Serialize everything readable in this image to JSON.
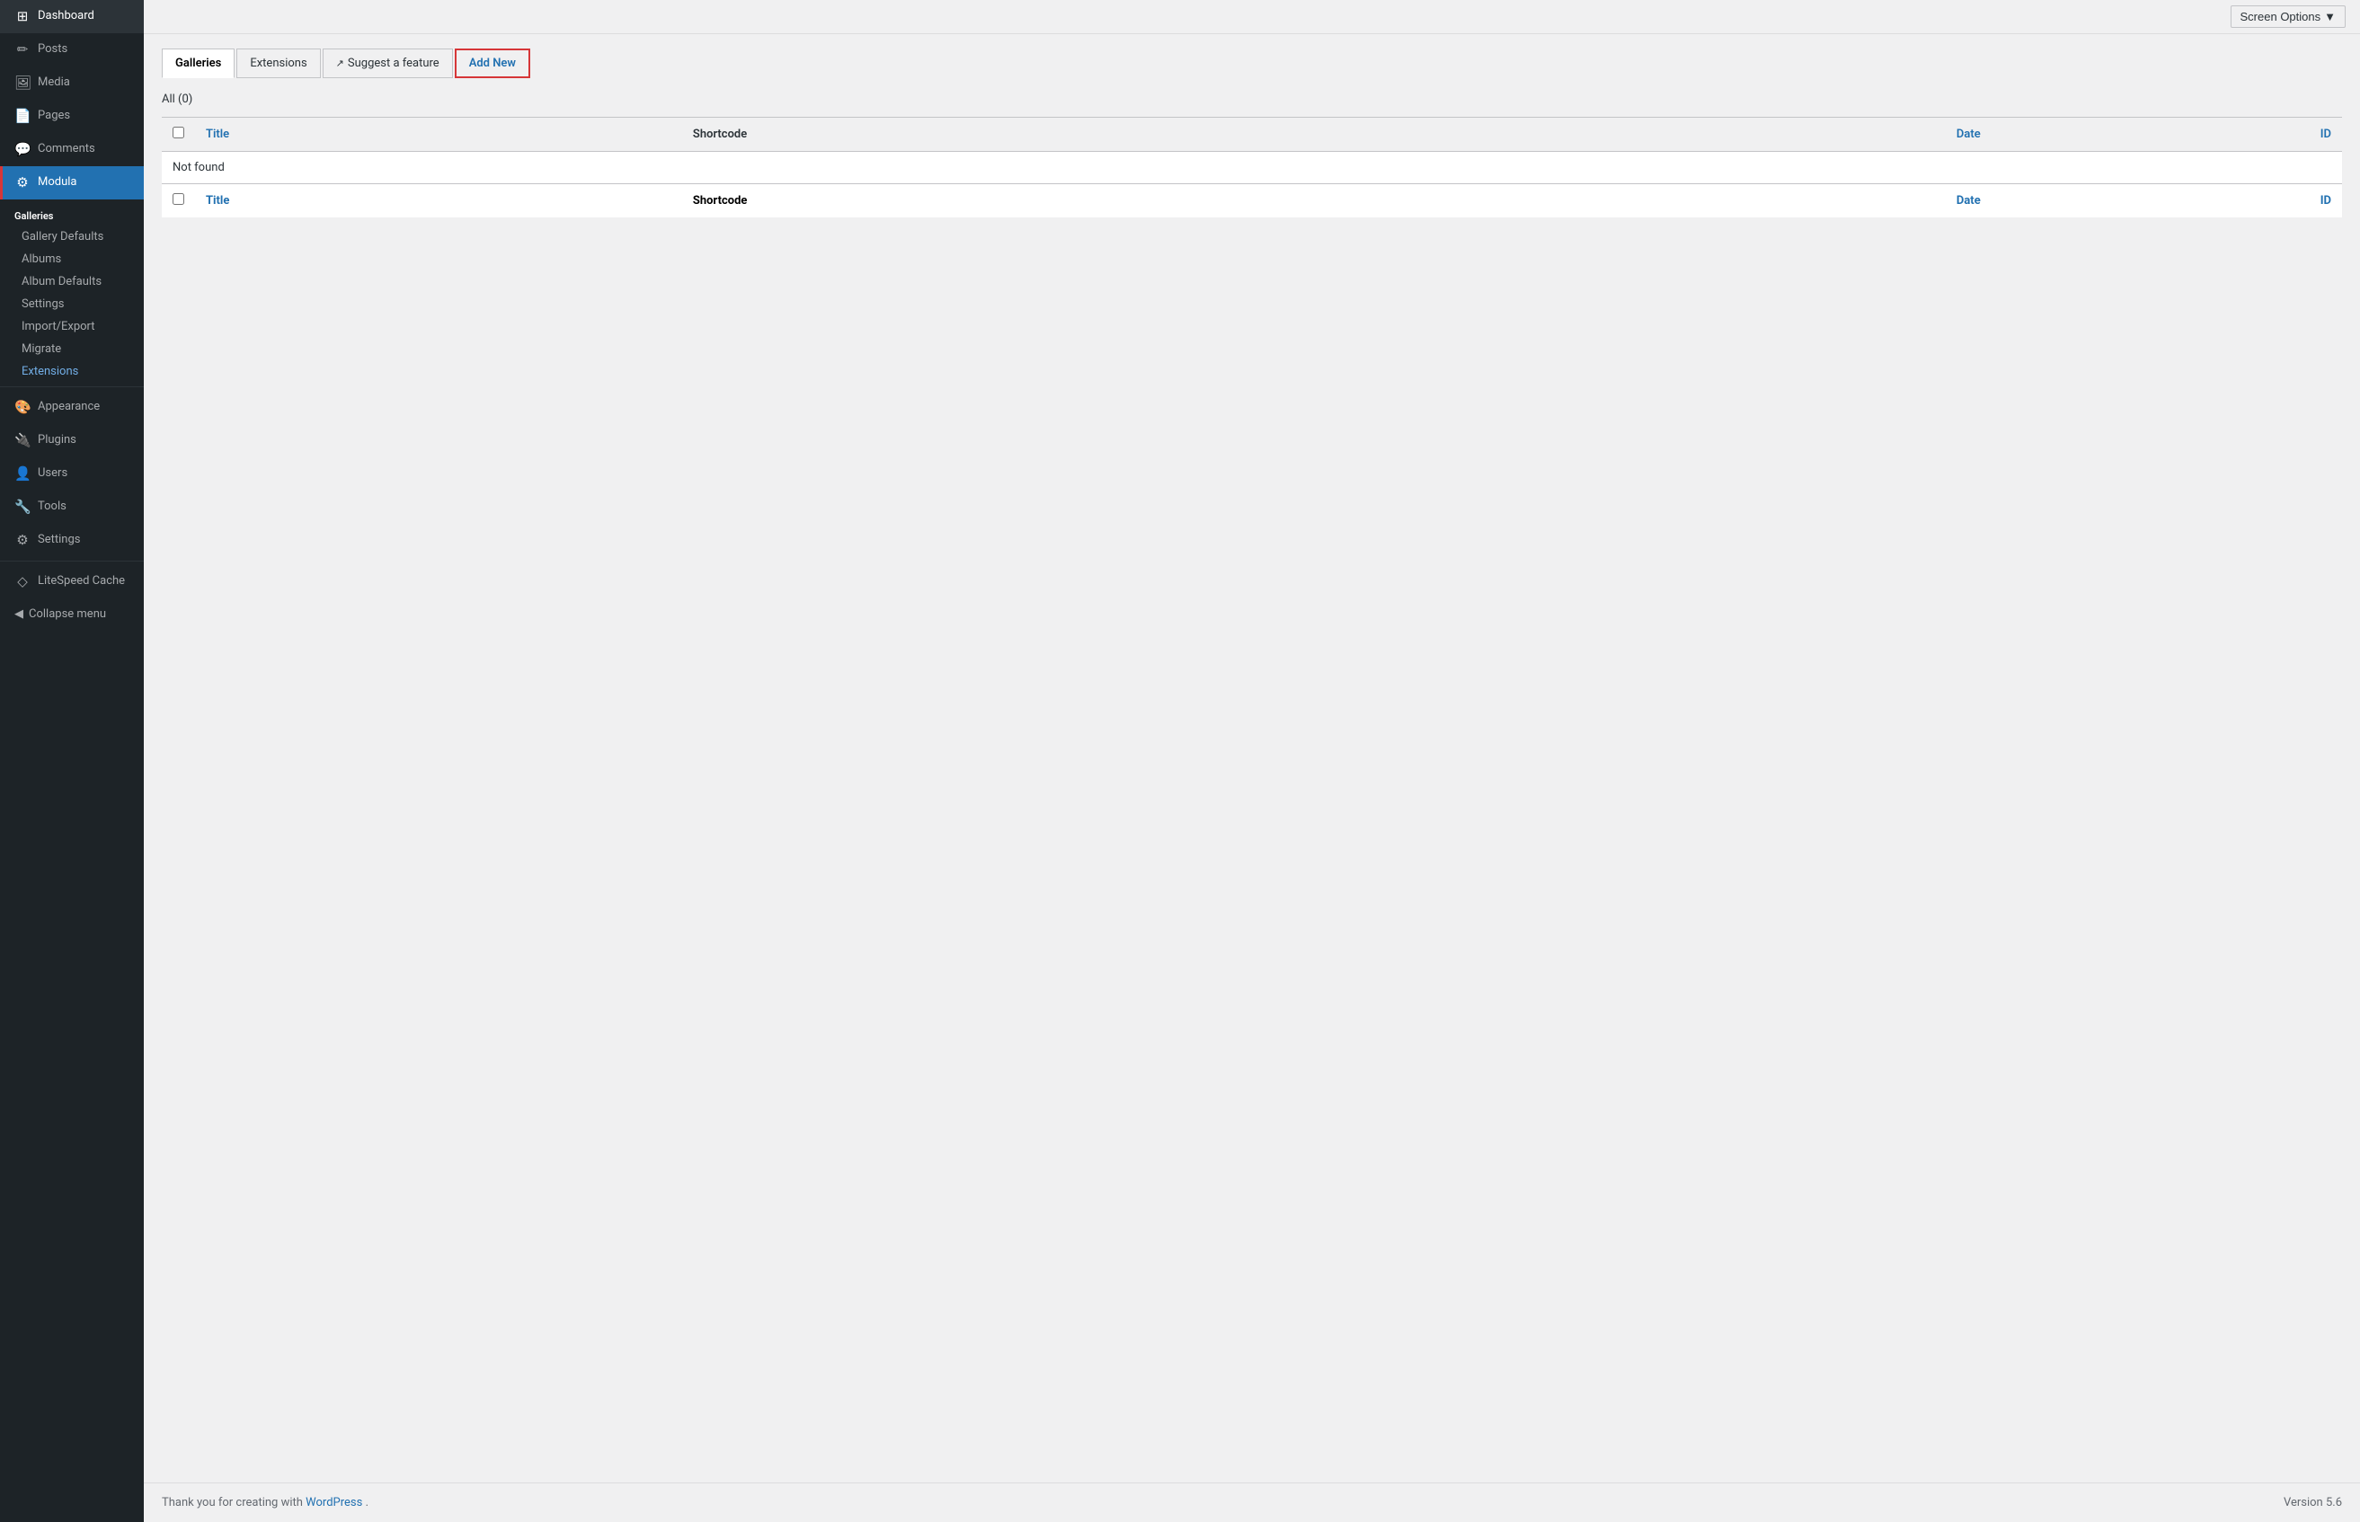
{
  "sidebar": {
    "items": [
      {
        "id": "dashboard",
        "label": "Dashboard",
        "icon": "⊞"
      },
      {
        "id": "posts",
        "label": "Posts",
        "icon": "📝"
      },
      {
        "id": "media",
        "label": "Media",
        "icon": "🖼"
      },
      {
        "id": "pages",
        "label": "Pages",
        "icon": "📄"
      },
      {
        "id": "comments",
        "label": "Comments",
        "icon": "💬"
      },
      {
        "id": "modula",
        "label": "Modula",
        "icon": "⚙",
        "active": true
      }
    ],
    "galleries_section": {
      "label": "Galleries",
      "subitems": [
        {
          "id": "gallery-defaults",
          "label": "Gallery Defaults",
          "active": false
        },
        {
          "id": "albums",
          "label": "Albums"
        },
        {
          "id": "album-defaults",
          "label": "Album Defaults"
        },
        {
          "id": "settings",
          "label": "Settings"
        },
        {
          "id": "import-export",
          "label": "Import/Export"
        },
        {
          "id": "migrate",
          "label": "Migrate"
        },
        {
          "id": "extensions",
          "label": "Extensions",
          "active_sub": true
        }
      ]
    },
    "bottom_items": [
      {
        "id": "appearance",
        "label": "Appearance",
        "icon": "🎨"
      },
      {
        "id": "plugins",
        "label": "Plugins",
        "icon": "🔌"
      },
      {
        "id": "users",
        "label": "Users",
        "icon": "👤"
      },
      {
        "id": "tools",
        "label": "Tools",
        "icon": "🔧"
      },
      {
        "id": "settings",
        "label": "Settings",
        "icon": "⚙"
      },
      {
        "id": "litespeed",
        "label": "LiteSpeed Cache",
        "icon": "◇"
      }
    ],
    "collapse_label": "Collapse menu"
  },
  "header": {
    "screen_options": "Screen Options"
  },
  "tabs": [
    {
      "id": "galleries",
      "label": "Galleries",
      "active": true
    },
    {
      "id": "extensions",
      "label": "Extensions"
    },
    {
      "id": "suggest",
      "label": "Suggest a feature",
      "external": true
    },
    {
      "id": "add-new",
      "label": "Add New",
      "highlighted": true
    }
  ],
  "filter": {
    "all_label": "All",
    "count": "(0)"
  },
  "table": {
    "columns": [
      {
        "id": "title",
        "label": "Title",
        "link": true
      },
      {
        "id": "shortcode",
        "label": "Shortcode"
      },
      {
        "id": "date",
        "label": "Date",
        "link": true
      },
      {
        "id": "id",
        "label": "ID",
        "link": true
      }
    ],
    "empty_message": "Not found",
    "rows": []
  },
  "footer": {
    "thank_you": "Thank you for creating with",
    "wp_link_text": "WordPress",
    "version": "Version 5.6"
  }
}
